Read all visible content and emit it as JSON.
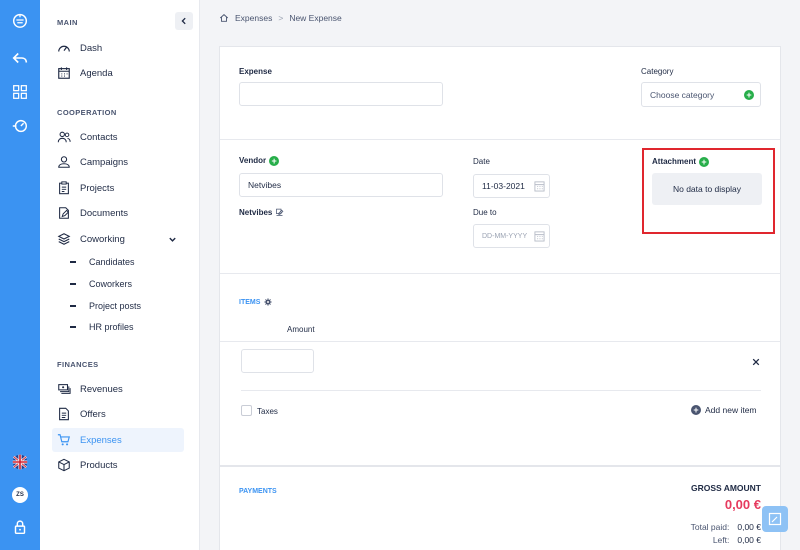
{
  "sidebar": {
    "sections": {
      "main": "MAIN",
      "cooperation": "COOPERATION",
      "finances": "FINANCES"
    },
    "items": {
      "dash": "Dash",
      "agenda": "Agenda",
      "contacts": "Contacts",
      "campaigns": "Campaigns",
      "projects": "Projects",
      "documents": "Documents",
      "coworking": "Coworking",
      "revenues": "Revenues",
      "offers": "Offers",
      "expenses": "Expenses",
      "products": "Products"
    },
    "coworking_sub": [
      "Candidates",
      "Coworkers",
      "Project posts",
      "HR profiles"
    ]
  },
  "rail": {
    "user_initials": "ZS"
  },
  "breadcrumb": {
    "root": "Expenses",
    "separator": ">",
    "current": "New Expense"
  },
  "form": {
    "expense_label": "Expense",
    "expense_value": "",
    "category_label": "Category",
    "category_placeholder": "Choose category",
    "vendor_label": "Vendor",
    "vendor_value": "Netvibes",
    "vendor_name": "Netvibes",
    "date_label": "Date",
    "date_value": "11-03-2021",
    "due_label": "Due to",
    "due_placeholder": "DD-MM-YYYY",
    "attachment_label": "Attachment",
    "attachment_empty": "No data to display"
  },
  "items": {
    "title": "ITEMS",
    "amount_header": "Amount",
    "taxes_label": "Taxes",
    "add_label": "Add new item"
  },
  "payments": {
    "title": "PAYMENTS",
    "gross_label": "GROSS AMOUNT",
    "gross_value": "0,00 €",
    "total_paid_label": "Total paid:",
    "total_paid_value": "0,00 €",
    "left_label": "Left:",
    "left_value": "0,00 €"
  },
  "colors": {
    "accent": "#3b93f2",
    "highlight": "#e0262e",
    "green": "#27ae4a",
    "amount_red": "#e63a5e"
  }
}
